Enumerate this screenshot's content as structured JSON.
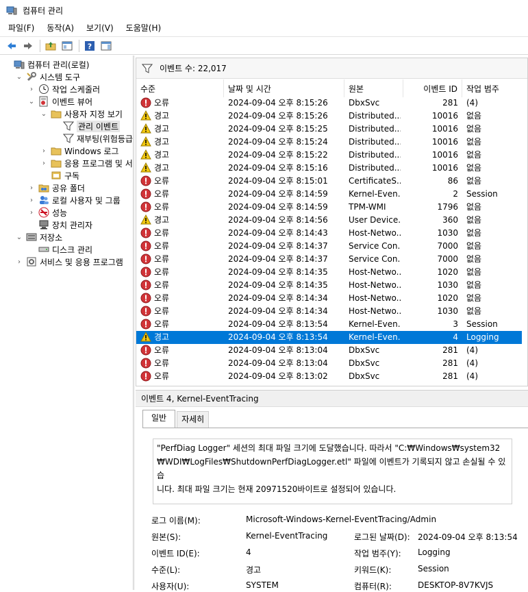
{
  "window": {
    "title": "컴퓨터 관리"
  },
  "menu": [
    "파일(F)",
    "동작(A)",
    "보기(V)",
    "도움말(H)"
  ],
  "toolbar": {
    "buttons": [
      "back-icon",
      "forward-icon",
      "up-folder-icon",
      "show-hide-tree-icon",
      "help-icon",
      "action-pane-icon"
    ]
  },
  "tree": {
    "items": [
      {
        "label": "컴퓨터 관리(로컬)",
        "icon": "computer-management-icon",
        "twisty": "",
        "depth": 0
      },
      {
        "label": "시스템 도구",
        "icon": "tools-icon",
        "twisty": "⌄",
        "depth": 1
      },
      {
        "label": "작업 스케줄러",
        "icon": "clock-icon",
        "twisty": "›",
        "depth": 2
      },
      {
        "label": "이벤트 뷰어",
        "icon": "event-viewer-icon",
        "twisty": "⌄",
        "depth": 2
      },
      {
        "label": "사용자 지정 보기",
        "icon": "folder-icon",
        "twisty": "⌄",
        "depth": 3
      },
      {
        "label": "관리 이벤트",
        "icon": "filter-icon",
        "twisty": "",
        "depth": 4
      },
      {
        "label": "재부팅(위험등급",
        "icon": "filter-icon",
        "twisty": "",
        "depth": 4
      },
      {
        "label": "Windows 로그",
        "icon": "folder-icon",
        "twisty": "›",
        "depth": 3
      },
      {
        "label": "응용 프로그램 및 서",
        "icon": "folder-icon",
        "twisty": "›",
        "depth": 3
      },
      {
        "label": "구독",
        "icon": "subscription-icon",
        "twisty": "",
        "depth": 3
      },
      {
        "label": "공유 폴더",
        "icon": "shared-folder-icon",
        "twisty": "›",
        "depth": 2
      },
      {
        "label": "로컬 사용자 및 그룹",
        "icon": "users-icon",
        "twisty": "›",
        "depth": 2
      },
      {
        "label": "성능",
        "icon": "performance-icon",
        "twisty": "›",
        "depth": 2
      },
      {
        "label": "장치 관리자",
        "icon": "device-manager-icon",
        "twisty": "",
        "depth": 2
      },
      {
        "label": "저장소",
        "icon": "storage-icon",
        "twisty": "⌄",
        "depth": 1
      },
      {
        "label": "디스크 관리",
        "icon": "disk-icon",
        "twisty": "",
        "depth": 2
      },
      {
        "label": "서비스 및 응용 프로그램",
        "icon": "services-icon",
        "twisty": "›",
        "depth": 1
      }
    ],
    "selected_index": 5
  },
  "events": {
    "header": "이벤트 수: 22,017",
    "columns": [
      "수준",
      "날짜 및 시간",
      "원본",
      "이벤트 ID",
      "작업 범주"
    ],
    "rows": [
      {
        "level": "오류",
        "icon": "error-icon",
        "datetime": "2024-09-04 오후 8:15:26",
        "source": "DbxSvc",
        "id": "281",
        "category": "(4)"
      },
      {
        "level": "경고",
        "icon": "warning-icon",
        "datetime": "2024-09-04 오후 8:15:26",
        "source": "Distributed...",
        "id": "10016",
        "category": "없음"
      },
      {
        "level": "경고",
        "icon": "warning-icon",
        "datetime": "2024-09-04 오후 8:15:25",
        "source": "Distributed...",
        "id": "10016",
        "category": "없음"
      },
      {
        "level": "경고",
        "icon": "warning-icon",
        "datetime": "2024-09-04 오후 8:15:24",
        "source": "Distributed...",
        "id": "10016",
        "category": "없음"
      },
      {
        "level": "경고",
        "icon": "warning-icon",
        "datetime": "2024-09-04 오후 8:15:22",
        "source": "Distributed...",
        "id": "10016",
        "category": "없음"
      },
      {
        "level": "경고",
        "icon": "warning-icon",
        "datetime": "2024-09-04 오후 8:15:16",
        "source": "Distributed...",
        "id": "10016",
        "category": "없음"
      },
      {
        "level": "오류",
        "icon": "error-icon",
        "datetime": "2024-09-04 오후 8:15:01",
        "source": "CertificateS...",
        "id": "86",
        "category": "없음"
      },
      {
        "level": "오류",
        "icon": "error-icon",
        "datetime": "2024-09-04 오후 8:14:59",
        "source": "Kernel-Even...",
        "id": "2",
        "category": "Session"
      },
      {
        "level": "오류",
        "icon": "error-icon",
        "datetime": "2024-09-04 오후 8:14:59",
        "source": "TPM-WMI",
        "id": "1796",
        "category": "없음"
      },
      {
        "level": "경고",
        "icon": "warning-icon",
        "datetime": "2024-09-04 오후 8:14:56",
        "source": "User Device...",
        "id": "360",
        "category": "없음"
      },
      {
        "level": "오류",
        "icon": "error-icon",
        "datetime": "2024-09-04 오후 8:14:43",
        "source": "Host-Netwo...",
        "id": "1030",
        "category": "없음"
      },
      {
        "level": "오류",
        "icon": "error-icon",
        "datetime": "2024-09-04 오후 8:14:37",
        "source": "Service Con...",
        "id": "7000",
        "category": "없음"
      },
      {
        "level": "오류",
        "icon": "error-icon",
        "datetime": "2024-09-04 오후 8:14:37",
        "source": "Service Con...",
        "id": "7000",
        "category": "없음"
      },
      {
        "level": "오류",
        "icon": "error-icon",
        "datetime": "2024-09-04 오후 8:14:35",
        "source": "Host-Netwo...",
        "id": "1020",
        "category": "없음"
      },
      {
        "level": "오류",
        "icon": "error-icon",
        "datetime": "2024-09-04 오후 8:14:35",
        "source": "Host-Netwo...",
        "id": "1030",
        "category": "없음"
      },
      {
        "level": "오류",
        "icon": "error-icon",
        "datetime": "2024-09-04 오후 8:14:34",
        "source": "Host-Netwo...",
        "id": "1020",
        "category": "없음"
      },
      {
        "level": "오류",
        "icon": "error-icon",
        "datetime": "2024-09-04 오후 8:14:34",
        "source": "Host-Netwo...",
        "id": "1030",
        "category": "없음"
      },
      {
        "level": "오류",
        "icon": "error-icon",
        "datetime": "2024-09-04 오후 8:13:54",
        "source": "Kernel-Even...",
        "id": "3",
        "category": "Session"
      },
      {
        "level": "경고",
        "icon": "warning-icon",
        "datetime": "2024-09-04 오후 8:13:54",
        "source": "Kernel-Even...",
        "id": "4",
        "category": "Logging"
      },
      {
        "level": "오류",
        "icon": "error-icon",
        "datetime": "2024-09-04 오후 8:13:04",
        "source": "DbxSvc",
        "id": "281",
        "category": "(4)"
      },
      {
        "level": "오류",
        "icon": "error-icon",
        "datetime": "2024-09-04 오후 8:13:04",
        "source": "DbxSvc",
        "id": "281",
        "category": "(4)"
      },
      {
        "level": "오류",
        "icon": "error-icon",
        "datetime": "2024-09-04 오후 8:13:02",
        "source": "DbxSvc",
        "id": "281",
        "category": "(4)"
      }
    ],
    "selected_index": 18
  },
  "detail": {
    "title": "이벤트 4, Kernel-EventTracing",
    "tabs": [
      "일반",
      "자세히"
    ],
    "message_lines": [
      "\"PerfDiag Logger\" 세션의 최대 파일 크기에 도달했습니다. 따라서 \"C:₩Windows₩system32",
      "₩WDI₩LogFiles₩ShutdownPerfDiagLogger.etl\" 파일에 이벤트가 기록되지 않고 손실될 수 있습",
      "니다. 최대 파일 크기는 현재 20971520바이트로 설정되어 있습니다."
    ],
    "log_name_label": "로그 이름(M):",
    "log_name_value": "Microsoft-Windows-Kernel-EventTracing/Admin",
    "source_label": "원본(S):",
    "source_value": "Kernel-EventTracing",
    "logged_label": "로그된 날짜(D):",
    "logged_value": "2024-09-04 오후 8:13:54",
    "eventid_label": "이벤트 ID(E):",
    "eventid_value": "4",
    "category_label": "작업 범주(Y):",
    "category_value": "Logging",
    "level_label": "수준(L):",
    "level_value": "경고",
    "keyword_label": "키워드(K):",
    "keyword_value": "Session",
    "user_label": "사용자(U):",
    "user_value": "SYSTEM",
    "computer_label": "컴퓨터(R):",
    "computer_value": "DESKTOP-8V7KVJS"
  },
  "colors": {
    "selection": "#0078d7",
    "error": "#d13438",
    "warning": "#f2c811"
  }
}
